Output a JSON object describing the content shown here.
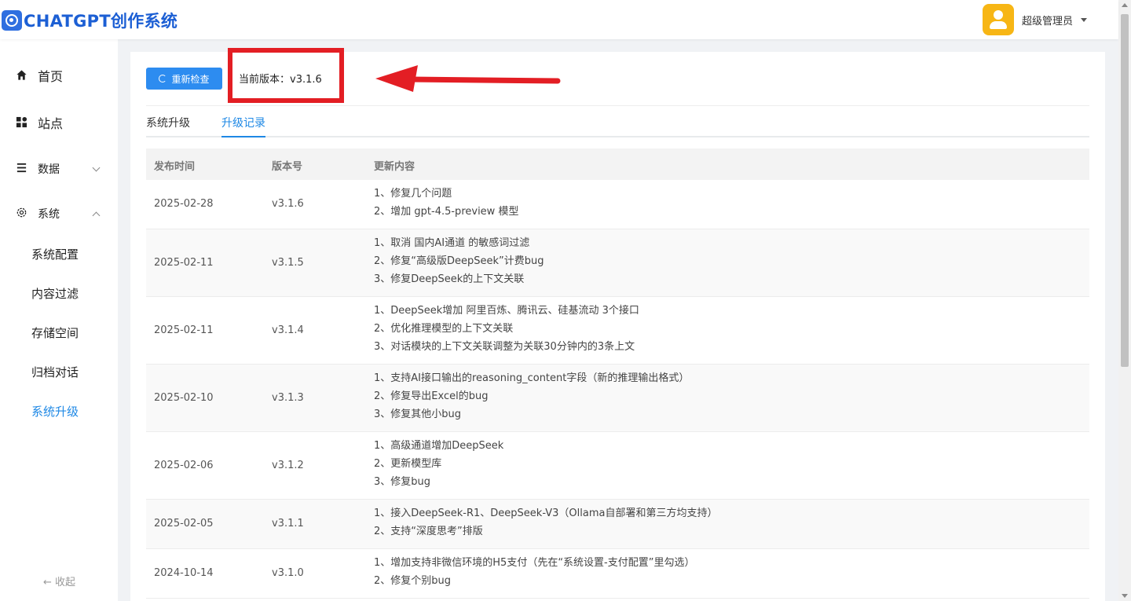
{
  "header": {
    "logo_text": "CHATGPT创作系统",
    "user_name": "超级管理员"
  },
  "sidebar": {
    "items": [
      {
        "label": "首页",
        "icon": "home-icon"
      },
      {
        "label": "站点",
        "icon": "grid-icon"
      },
      {
        "label": "数据",
        "icon": "list-icon"
      },
      {
        "label": "系统",
        "icon": "gear-icon"
      }
    ],
    "sub_items": [
      "系统配置",
      "内容过滤",
      "存储空间",
      "归档对话",
      "系统升级"
    ],
    "active_sub": "系统升级",
    "collapse_label": "← 收起"
  },
  "toolbar": {
    "recheck_label": "重新检查",
    "version_text": "当前版本：v3.1.6"
  },
  "tabs": [
    "系统升级",
    "升级记录"
  ],
  "active_tab": "升级记录",
  "table": {
    "headers": [
      "发布时间",
      "版本号",
      "更新内容"
    ],
    "rows": [
      {
        "date": "2025-02-28",
        "version": "v3.1.6",
        "notes": [
          "1、修复几个问题",
          "2、增加 gpt-4.5-preview 模型"
        ]
      },
      {
        "date": "2025-02-11",
        "version": "v3.1.5",
        "notes": [
          "1、取消 国内AI通道 的敏感词过滤",
          "2、修复“高级版DeepSeek”计费bug",
          "3、修复DeepSeek的上下文关联"
        ]
      },
      {
        "date": "2025-02-11",
        "version": "v3.1.4",
        "notes": [
          "1、DeepSeek增加 阿里百炼、腾讯云、硅基流动 3个接口",
          "2、优化推理模型的上下文关联",
          "3、对话模块的上下文关联调整为关联30分钟内的3条上文"
        ]
      },
      {
        "date": "2025-02-10",
        "version": "v3.1.3",
        "notes": [
          "1、支持AI接口输出的reasoning_content字段（新的推理输出格式）",
          "2、修复导出Excel的bug",
          "3、修复其他小bug"
        ]
      },
      {
        "date": "2025-02-06",
        "version": "v3.1.2",
        "notes": [
          "1、高级通道增加DeepSeek",
          "2、更新模型库",
          "3、修复bug"
        ]
      },
      {
        "date": "2025-02-05",
        "version": "v3.1.1",
        "notes": [
          "1、接入DeepSeek-R1、DeepSeek-V3（Ollama自部署和第三方均支持）",
          "2、支持“深度思考”排版"
        ]
      },
      {
        "date": "2024-10-14",
        "version": "v3.1.0",
        "notes": [
          "1、增加支持非微信环境的H5支付（先在“系统设置-支付配置”里勾选）",
          "2、修复个别bug"
        ]
      }
    ]
  },
  "colors": {
    "primary": "#2d8cf0",
    "accent": "#1e88e5",
    "highlight": "#e31e24",
    "avatar": "#f7b615"
  }
}
